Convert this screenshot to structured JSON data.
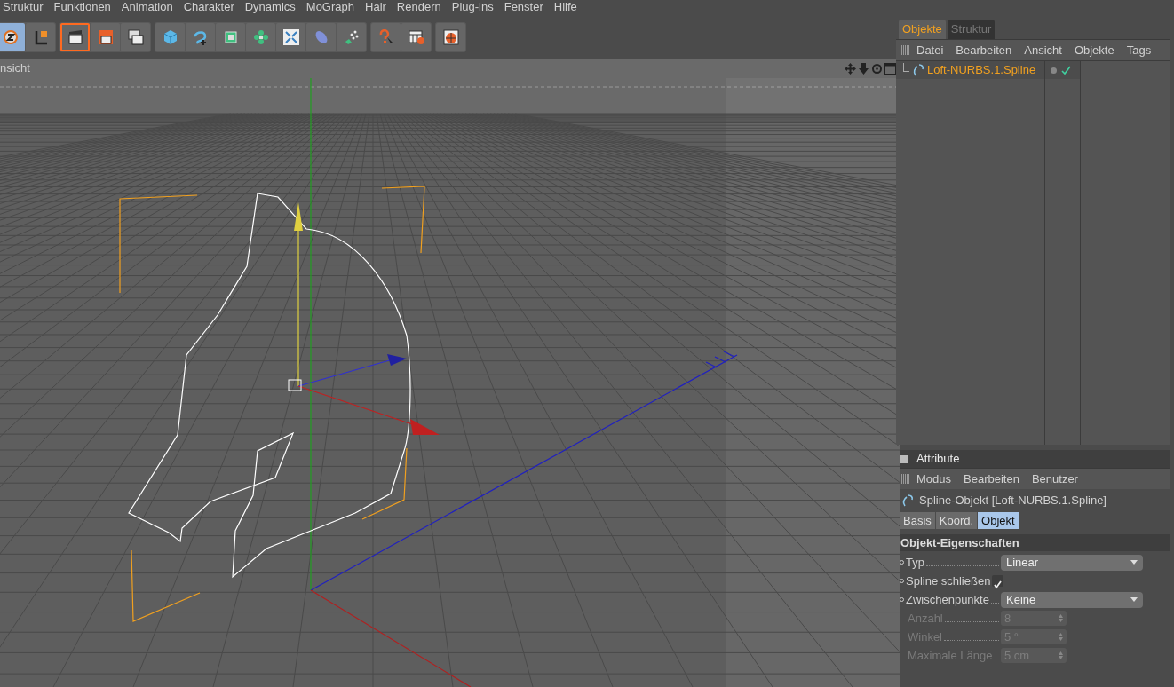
{
  "menu": [
    "Struktur",
    "Funktionen",
    "Animation",
    "Charakter",
    "Dynamics",
    "MoGraph",
    "Hair",
    "Rendern",
    "Plug-ins",
    "Fenster",
    "Hilfe"
  ],
  "toolbar": [
    [
      {
        "kind": "zoom",
        "selected": true
      },
      {
        "kind": "axis",
        "selected": false
      }
    ],
    [
      {
        "kind": "render",
        "selected": true
      },
      {
        "kind": "render-region",
        "selected": false
      },
      {
        "kind": "render-settings",
        "selected": false
      }
    ],
    [
      {
        "kind": "cube",
        "selected": false
      },
      {
        "kind": "spline",
        "selected": false
      },
      {
        "kind": "nurbs",
        "selected": false
      },
      {
        "kind": "array",
        "selected": false
      },
      {
        "kind": "deformer",
        "selected": false
      },
      {
        "kind": "environment",
        "selected": false
      },
      {
        "kind": "particles",
        "selected": false
      }
    ],
    [
      {
        "kind": "help",
        "selected": false
      },
      {
        "kind": "help-table",
        "selected": false
      }
    ],
    [
      {
        "kind": "globe",
        "selected": false
      }
    ]
  ],
  "viewport": {
    "title": "nsicht"
  },
  "objects": {
    "tabs": [
      {
        "label": "Objekte",
        "selected": true
      },
      {
        "label": "Struktur",
        "selected": false
      }
    ],
    "menu": [
      "Datei",
      "Bearbeiten",
      "Ansicht",
      "Objekte",
      "Tags"
    ],
    "rows": [
      {
        "name": "Loft-NURBS.1.Spline",
        "enabled": true
      }
    ]
  },
  "attributes": {
    "title": "Attribute",
    "menu": [
      "Modus",
      "Bearbeiten",
      "Benutzer"
    ],
    "object": "Spline-Objekt [Loft-NURBS.1.Spline]",
    "tabs": [
      {
        "label": "Basis",
        "selected": false
      },
      {
        "label": "Koord.",
        "selected": false
      },
      {
        "label": "Objekt",
        "selected": true
      }
    ],
    "section": "Objekt-Eigenschaften",
    "fields": [
      {
        "kind": "select",
        "label": "Typ",
        "value": "Linear",
        "disabled": false
      },
      {
        "kind": "checkbox",
        "label": "Spline schließen",
        "checked": true,
        "disabled": false
      },
      {
        "kind": "select",
        "label": "Zwischenpunkte",
        "value": "Keine",
        "disabled": false
      },
      {
        "kind": "spinner",
        "label": "Anzahl",
        "value": "8",
        "disabled": true
      },
      {
        "kind": "spinner",
        "label": "Winkel",
        "value": "5 °",
        "disabled": true
      },
      {
        "kind": "spinner",
        "label": "Maximale Länge",
        "value": "5 cm",
        "disabled": true
      }
    ]
  }
}
